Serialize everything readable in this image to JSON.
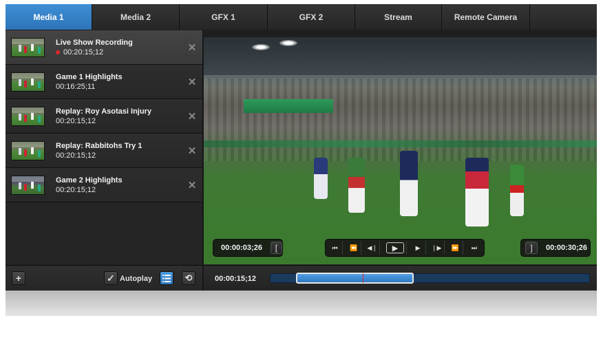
{
  "tabs": [
    {
      "label": "Media 1",
      "active": true
    },
    {
      "label": "Media 2"
    },
    {
      "label": "GFX 1"
    },
    {
      "label": "GFX 2"
    },
    {
      "label": "Stream"
    },
    {
      "label": "Remote Camera"
    },
    {
      "label": ""
    }
  ],
  "playlist": {
    "items": [
      {
        "title": "Live Show Recording",
        "duration": "00:20:15;12",
        "recording": true,
        "active": true
      },
      {
        "title": "Game 1 Highlights",
        "duration": "00:16:25;11"
      },
      {
        "title": "Replay: Roy Asotasi Injury",
        "duration": "00:20:15;12"
      },
      {
        "title": "Replay: Rabbitohs Try 1",
        "duration": "00:20:15;12"
      },
      {
        "title": "Game 2 Highlights",
        "duration": "00:20:15;12"
      }
    ],
    "close_glyph": "✕"
  },
  "toolbar": {
    "add_glyph": "+",
    "autoplay_label": "Autoplay",
    "autoplay_checked": true,
    "check_glyph": "✓",
    "list_mode_active": true,
    "loop_glyph": "⟲"
  },
  "viewer": {
    "in_timecode": "00:00:03;26",
    "out_timecode": "00:00:30;26",
    "in_bracket": "[",
    "out_bracket": "]",
    "transport": {
      "first": "⏮",
      "step_back_long": "⏪",
      "step_back": "◀❘",
      "play": "▶",
      "forward": "▶",
      "step_forward": "❘▶",
      "step_forward_long": "⏩",
      "last": "⏭"
    }
  },
  "timeline": {
    "current_timecode": "00:00:15;12",
    "range_start": 0.08,
    "range_end": 0.45,
    "playhead": 0.29
  },
  "colors": {
    "accent": "#3a89d2",
    "record": "#e0262b",
    "track": "#1a3a5e"
  }
}
